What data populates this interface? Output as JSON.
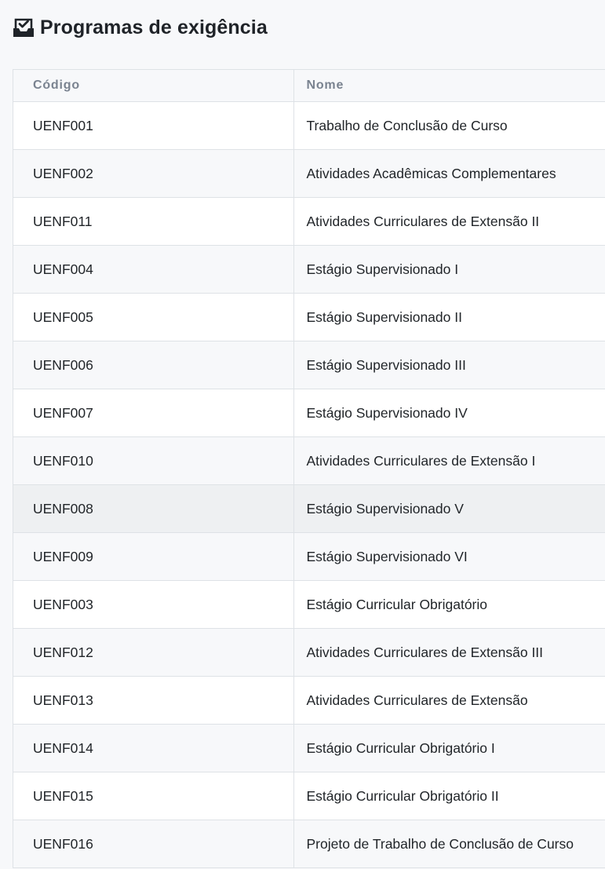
{
  "header": {
    "title": "Programas de exigência",
    "icon": "inbox-check-icon"
  },
  "table": {
    "columns": [
      "Código",
      "Nome"
    ],
    "rows": [
      {
        "code": "UENF001",
        "name": "Trabalho de Conclusão de Curso"
      },
      {
        "code": "UENF002",
        "name": "Atividades Acadêmicas Complementares"
      },
      {
        "code": "UENF011",
        "name": "Atividades Curriculares de Extensão II"
      },
      {
        "code": "UENF004",
        "name": "Estágio Supervisionado I"
      },
      {
        "code": "UENF005",
        "name": "Estágio Supervisionado II"
      },
      {
        "code": "UENF006",
        "name": "Estágio Supervisionado III"
      },
      {
        "code": "UENF007",
        "name": "Estágio Supervisionado IV"
      },
      {
        "code": "UENF010",
        "name": "Atividades Curriculares de Extensão I"
      },
      {
        "code": "UENF008",
        "name": "Estágio Supervisionado V"
      },
      {
        "code": "UENF009",
        "name": "Estágio Supervisionado VI"
      },
      {
        "code": "UENF003",
        "name": "Estágio Curricular Obrigatório"
      },
      {
        "code": "UENF012",
        "name": "Atividades Curriculares de Extensão III"
      },
      {
        "code": "UENF013",
        "name": "Atividades Curriculares de Extensão"
      },
      {
        "code": "UENF014",
        "name": "Estágio Curricular Obrigatório I"
      },
      {
        "code": "UENF015",
        "name": "Estágio Curricular Obrigatório II"
      },
      {
        "code": "UENF016",
        "name": "Projeto de Trabalho de Conclusão de Curso"
      }
    ]
  }
}
